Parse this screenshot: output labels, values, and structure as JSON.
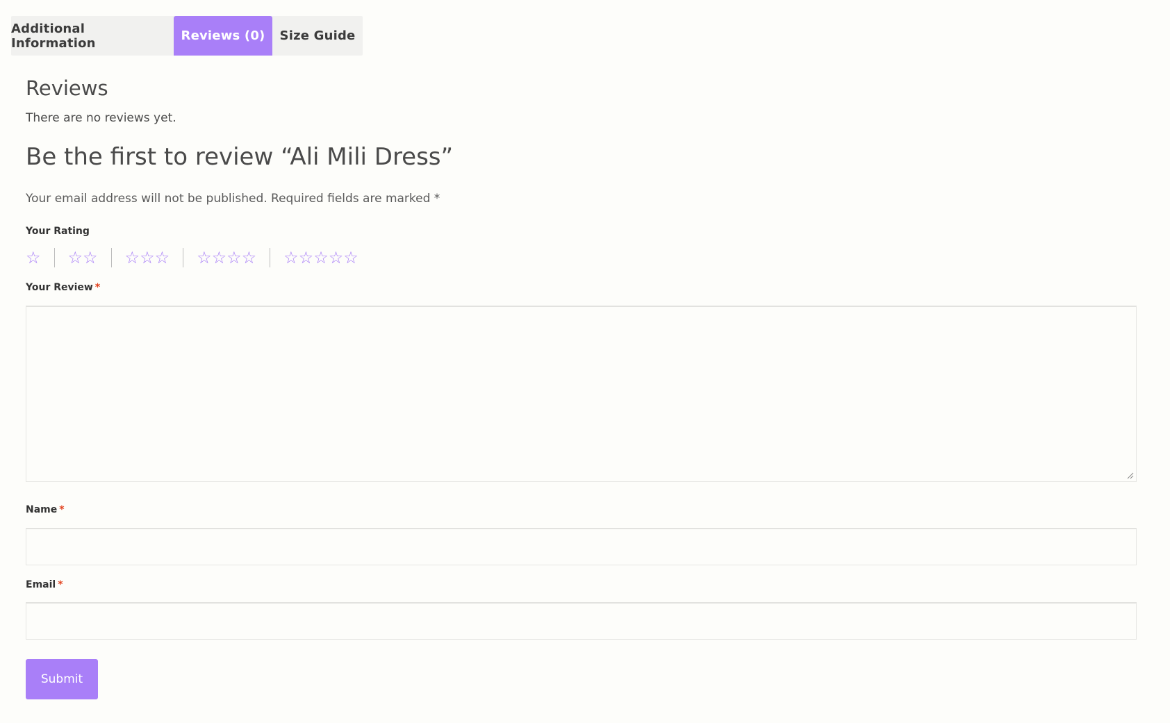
{
  "colors": {
    "accent": "#a97ff8",
    "background": "#fdfdfa",
    "tab_inactive_bg": "#f1f1ef",
    "required": "#e2401c"
  },
  "tabs": [
    {
      "label": "Additional Information",
      "active": false
    },
    {
      "label": "Reviews (0)",
      "active": true
    },
    {
      "label": "Size Guide",
      "active": false
    }
  ],
  "reviews": {
    "title": "Reviews",
    "empty_text": "There are no reviews yet."
  },
  "form": {
    "title": "Be the first to review “Ali Mili Dress”",
    "notes": "Your email address will not be published. Required fields are marked *",
    "rating_label": "Your Rating",
    "rating_options": [
      1,
      2,
      3,
      4,
      5
    ],
    "star_icon": "star-outline-icon",
    "review_label": "Your Review",
    "review_value": "",
    "name_label": "Name",
    "name_value": "",
    "email_label": "Email",
    "email_value": "",
    "required_mark": "*",
    "submit_label": "Submit"
  }
}
